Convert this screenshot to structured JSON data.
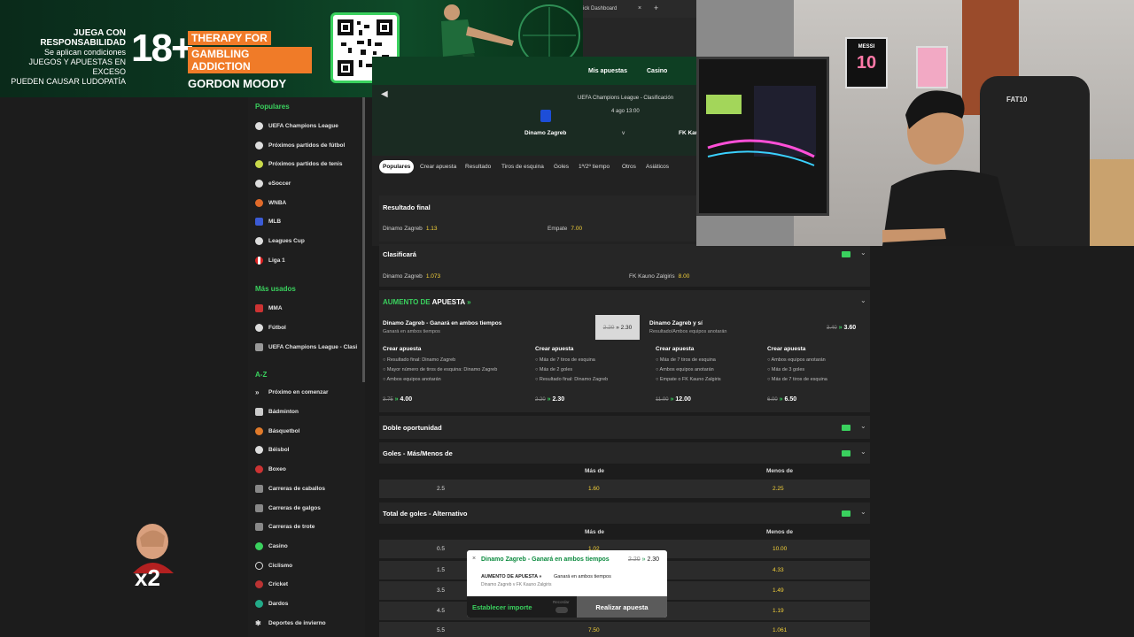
{
  "banner": {
    "resp_title": "JUEGA CON RESPONSABILIDAD",
    "resp_line2": "Se aplican condiciones",
    "resp_line3": "JUEGOS Y APUESTAS EN EXCESO",
    "resp_line4": "PUEDEN CAUSAR LUDOPATÍA",
    "age": "18+",
    "therapy_line1": "THERAPY FOR",
    "therapy_line2": "GAMBLING ADDICTION",
    "therapy_line3": "GORDON MOODY"
  },
  "browser": {
    "tab_title": "ick Dashboard",
    "close": "×",
    "new_tab": "+"
  },
  "nav": {
    "items": [
      "Mis apuestas",
      "Casino"
    ]
  },
  "hero": {
    "league": "UEFA Champions League - Clasificación",
    "date": "4 ago 13:00",
    "home": "Dinamo Zagreb",
    "vs": "v",
    "away": "FK Kau"
  },
  "tabs": [
    "Populares",
    "Crear apuesta",
    "Resultado",
    "Tiros de esquina",
    "Goles",
    "1ª/2º tiempo",
    "Otros",
    "Asiáticos"
  ],
  "sidebar": {
    "popular_title": "Populares",
    "popular": [
      "UEFA Champions League",
      "Próximos partidos de fútbol",
      "Próximos partidos de tenis",
      "eSoccer",
      "WNBA",
      "MLB",
      "Leagues Cup",
      "Liga 1"
    ],
    "most_used_title": "Más usados",
    "most_used": [
      "MMA",
      "Fútbol",
      "UEFA Champions League - Clasi"
    ],
    "az_title": "A-Z",
    "az": [
      "Próximo en comenzar",
      "Bádminton",
      "Básquetbol",
      "Béisbol",
      "Boxeo",
      "Carreras de caballos",
      "Carreras de galgos",
      "Carreras de trote",
      "Casino",
      "Ciclismo",
      "Cricket",
      "Dardos",
      "Deportes de invierno"
    ]
  },
  "markets": {
    "resultado_final": {
      "title": "Resultado final",
      "home": "Dinamo Zagreb",
      "home_odd": "1.13",
      "draw": "Empate",
      "draw_odd": "7.00"
    },
    "clasificara": {
      "title": "Clasificará",
      "home": "Dinamo Zagreb",
      "home_odd": "1.073",
      "away": "FK Kauno Zalgiris",
      "away_odd": "8.00"
    },
    "boost": {
      "title_a": "AUMENTO DE",
      "title_b": "APUESTA",
      "card1_title": "Dinamo Zagreb - Ganará en ambos tiempos",
      "card1_sub": "Ganará en ambos tiempos",
      "card1_old": "2.20",
      "card1_new": "2.30",
      "card2_title": "Dinamo Zagreb y sí",
      "card2_sub": "Resultado/Ambos equipos anotarán",
      "card2_old": "3.40",
      "card2_new": "3.60",
      "crear_label": "Crear apuesta",
      "col1": [
        "Resultado final: Dinamo Zagreb",
        "Mayor número de tiros de esquina: Dinamo Zagreb",
        "Ambos equipos anotarán"
      ],
      "col1_old": "3.75",
      "col1_new": "4.00",
      "col2": [
        "Más de 7 tiros de esquina",
        "Más de 2 goles",
        "Resultado final: Dinamo Zagreb"
      ],
      "col2_old": "2.20",
      "col2_new": "2.30",
      "col3": [
        "Más de 7 tiros de esquina",
        "Ambos equipos anotarán",
        "Empate o FK Kauno Zalgiris"
      ],
      "col3_old": "11.00",
      "col3_new": "12.00",
      "col4": [
        "Ambos equipos anotarán",
        "Más de 3 goles",
        "Más de 7 tiros de esquina"
      ],
      "col4_old": "6.00",
      "col4_new": "6.50"
    },
    "doble": {
      "title": "Doble oportunidad"
    },
    "goles": {
      "title": "Goles - Más/Menos de",
      "over": "Más de",
      "under": "Menos de",
      "line": "2.5",
      "over_odd": "1.60",
      "under_odd": "2.25"
    },
    "total": {
      "title": "Total de goles - Alternativo",
      "over": "Más de",
      "under": "Menos de",
      "rows": [
        {
          "line": "0.5",
          "over": "1.02",
          "under": "10.00"
        },
        {
          "line": "1.5",
          "over": "",
          "under": "4.33"
        },
        {
          "line": "3.5",
          "over": "",
          "under": "1.49"
        },
        {
          "line": "4.5",
          "over": "",
          "under": "1.19"
        },
        {
          "line": "5.5",
          "over": "7.50",
          "under": "1.061"
        }
      ]
    },
    "cashout": "CA",
    "chevron": "⌄"
  },
  "betslip": {
    "close": "×",
    "selection": "Dinamo Zagreb - Ganará en ambos tiempos",
    "old": "2.20",
    "new": "2.30",
    "boost": "AUMENTO DE APUESTA »",
    "market": "Ganará en ambos tiempos",
    "event": "Dinamo Zagreb v FK Kauno Zalgiris",
    "stake": "Establecer importe",
    "remember": "Recordar",
    "place": "Realizar apuesta"
  },
  "cam": {
    "poster_name": "MESSI",
    "poster_number": "10",
    "chair": "FAT10"
  },
  "emote": {
    "label": "x2"
  },
  "colors": {
    "accent": "#3ad15e",
    "odds": "#f4d13a",
    "nav_green": "#0e3f23"
  }
}
